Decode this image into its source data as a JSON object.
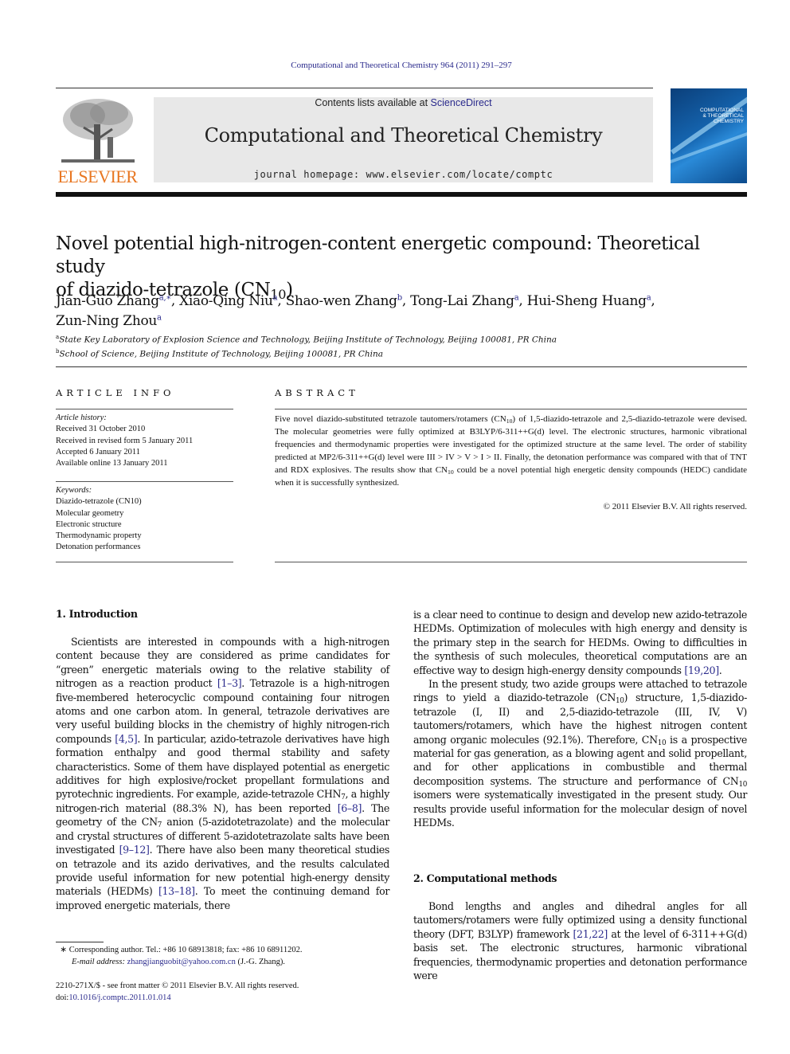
{
  "header": {
    "journal_ref": "Computational and Theoretical Chemistry 964 (2011) 291–297",
    "contents_prefix": "Contents lists available at ",
    "contents_link": "ScienceDirect",
    "journal_title": "Computational and Theoretical Chemistry",
    "homepage_prefix": "journal homepage: ",
    "homepage_url": "www.elsevier.com/locate/comptc",
    "publisher_logo_text": "ELSEVIER",
    "cover_title": [
      "COMPUTATIONAL",
      "& THEORETICAL",
      "CHEMISTRY"
    ],
    "colors": {
      "publisher_orange": "#e87722",
      "link_blue": "#2a2a8c",
      "banner_gray": "#e8e8e8",
      "cover_blue": "#1565b0"
    }
  },
  "article": {
    "title_line1": "Novel potential high-nitrogen-content energetic compound: Theoretical study",
    "title_line2_prefix": "of diazido-tetrazole (CN",
    "title_line2_sub": "10",
    "title_line2_suffix": ")",
    "authors": [
      {
        "name": "Jian-Guo Zhang",
        "aff": "a,∗",
        "sep": ", "
      },
      {
        "name": "Xiao-Qing Niu",
        "aff": "a",
        "sep": ", "
      },
      {
        "name": "Shao-wen Zhang",
        "aff": "b",
        "sep": ", "
      },
      {
        "name": "Tong-Lai Zhang",
        "aff": "a",
        "sep": ", "
      },
      {
        "name": "Hui-Sheng Huang",
        "aff": "a",
        "sep": ","
      },
      {
        "name": "Zun-Ning Zhou",
        "aff": "a",
        "sep": ""
      }
    ],
    "affiliations": [
      {
        "mark": "a",
        "text": "State Key Laboratory of Explosion Science and Technology, Beijing Institute of Technology, Beijing 100081, PR China"
      },
      {
        "mark": "b",
        "text": "School of Science, Beijing Institute of Technology, Beijing 100081, PR China"
      }
    ]
  },
  "article_info": {
    "heading": "ARTICLE INFO",
    "history_label": "Article history:",
    "history": [
      "Received 31 October 2010",
      "Received in revised form 5 January 2011",
      "Accepted 6 January 2011",
      "Available online 13 January 2011"
    ],
    "keywords_label": "Keywords:",
    "keywords": [
      "Diazido-tetrazole (CN10)",
      "Molecular geometry",
      "Electronic structure",
      "Thermodynamic property",
      "Detonation performances"
    ]
  },
  "abstract": {
    "heading": "ABSTRACT",
    "part1": "Five novel diazido-substituted tetrazole tautomers/rotamers (CN",
    "part2": ") of 1,5-diazido-tetrazole and 2,5-diazido-tetrazole were devised. The molecular geometries were fully optimized at B3LYP/6-311++G(d) level. The electronic structures, harmonic vibrational frequencies and thermodynamic properties were investigated for the optimized structure at the same level. The order of stability predicted at MP2/6-311++G(d) level were III > IV > V > I > II. Finally, the detonation performance was compared with that of TNT and RDX explosives. The results show that CN",
    "part3": " could be a novel potential high energetic density compounds (HEDC) candidate when it is successfully synthesized.",
    "sub": "10",
    "copyright": "© 2011 Elsevier B.V. All rights reserved."
  },
  "intro": {
    "heading": "1. Introduction",
    "t1": "Scientists are interested in compounds with a high-nitrogen content because they are considered as prime candidates for “green” energetic materials owing to the relative stability of nitrogen as a reaction product ",
    "r1": "[1–3]",
    "t2": ". Tetrazole is a high-nitrogen five-membered heterocyclic compound containing four nitrogen atoms and one carbon atom. In general, tetrazole derivatives are very useful building blocks in the chemistry of highly nitrogen-rich compounds ",
    "r2": "[4,5]",
    "t3": ". In particular, azido-tetrazole derivatives have high formation enthalpy and good thermal stability and safety characteristics. Some of them have displayed potential as energetic additives for high explosive/rocket propellant formulations and pyrotechnic ingredients. For example, azide-tetrazole CHN",
    "sub7a": "7",
    "t4": ", a highly nitrogen-rich material (88.3% N), has been reported ",
    "r3": "[6–8]",
    "t5": ". The geometry of the CN",
    "sub7b": "7",
    "t6": " anion (5-azidotetrazolate) and the molecular and crystal structures of different 5-azidotetrazolate salts have been investigated ",
    "r4": "[9–12]",
    "t7": ". There have also been many theoretical studies on tetrazole and its azido derivatives, and the results calculated provide useful information for new potential high-energy density materials (HEDMs) ",
    "r5": "[13–18]",
    "t8": ". To meet the continuing demand for improved energetic materials, there",
    "c2a": "is a clear need to continue to design and develop new azido-tetrazole HEDMs. Optimization of molecules with high energy and density is the primary step in the search for HEDMs. Owing to difficulties in the synthesis of such molecules, theoretical computations are an effective way to design high-energy density compounds ",
    "r6": "[19,20]",
    "c2b": ".",
    "p2a": "In the present study, two azide groups were attached to tetrazole rings to yield a diazido-tetrazole (CN",
    "p2b": ") structure, 1,5-diazido-tetrazole (I, II) and 2,5-diazido-tetrazole (III, IV, V) tautomers/rotamers, which have the highest nitrogen content among organic molecules (92.1%). Therefore, CN",
    "p2c": " is a prospective material for gas generation, as a blowing agent and solid propellant, and for other applications in combustible and thermal decomposition systems. The structure and performance of CN",
    "p2d": " isomers were systematically investigated in the present study. Our results provide useful information for the molecular design of novel HEDMs.",
    "sub10": "10"
  },
  "methods": {
    "heading": "2. Computational methods",
    "t1": "Bond lengths and angles and dihedral angles for all tautomers/rotamers were fully optimized using a density functional theory (DFT, B3LYP) framework ",
    "r1": "[21,22]",
    "t2": " at the level of 6-311++G(d) basis set. The electronic structures, harmonic vibrational frequencies, thermodynamic properties and detonation performance were"
  },
  "footnote": {
    "mark": "∗",
    "corresponding": " Corresponding author. Tel.: +86 10 68913818; fax: +86 10 68911202.",
    "email_label": "E-mail address: ",
    "email": "zhangjianguobit@yahoo.com.cn",
    "email_suffix": " (J.-G. Zhang).",
    "front_matter": "2210-271X/$ - see front matter © 2011 Elsevier B.V. All rights reserved.",
    "doi_label": "doi:",
    "doi": "10.1016/j.comptc.2011.01.014"
  }
}
